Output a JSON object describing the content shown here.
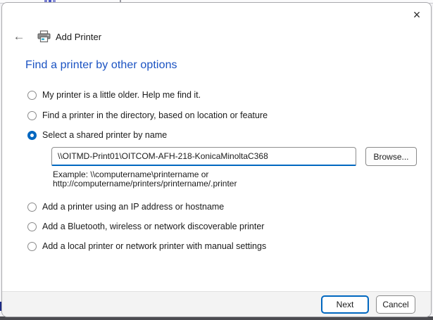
{
  "window": {
    "close_icon": "×"
  },
  "header": {
    "back_icon": "←",
    "title": "Add Printer"
  },
  "page": {
    "heading": "Find a printer by other options"
  },
  "options": [
    {
      "label": "My printer is a little older. Help me find it.",
      "selected": false
    },
    {
      "label": "Find a printer in the directory, based on location or feature",
      "selected": false
    },
    {
      "label": "Select a shared printer by name",
      "selected": true
    },
    {
      "label": "Add a printer using an IP address or hostname",
      "selected": false
    },
    {
      "label": "Add a Bluetooth, wireless or network discoverable printer",
      "selected": false
    },
    {
      "label": "Add a local printer or network printer with manual settings",
      "selected": false
    }
  ],
  "shared_printer": {
    "value": "\\\\OITMD-Print01\\OITCOM-AFH-218-KonicaMinoltaC368",
    "browse_label": "Browse...",
    "example_line1": "Example: \\\\computername\\printername or",
    "example_line2": "http://computername/printers/printername/.printer"
  },
  "footer": {
    "next_label": "Next",
    "cancel_label": "Cancel"
  },
  "colors": {
    "accent": "#0067c0",
    "heading_blue": "#1a52c2",
    "footer_bg": "#f3f3f3"
  }
}
